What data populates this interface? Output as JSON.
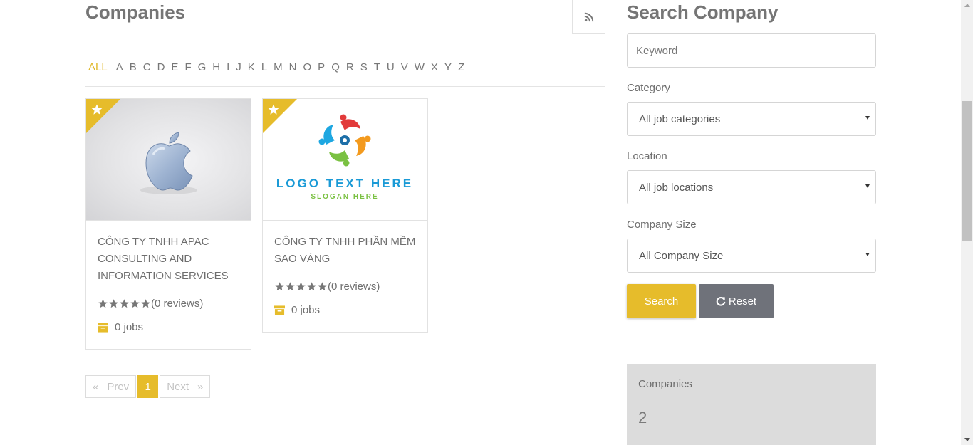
{
  "main": {
    "title": "Companies",
    "alphabet": [
      "ALL",
      "A",
      "B",
      "C",
      "D",
      "E",
      "F",
      "G",
      "H",
      "I",
      "J",
      "K",
      "L",
      "M",
      "N",
      "O",
      "P",
      "Q",
      "R",
      "S",
      "T",
      "U",
      "V",
      "W",
      "X",
      "Y",
      "Z"
    ],
    "active_letter": "ALL",
    "companies": [
      {
        "name": "CÔNG TY TNHH APAC CONSULTING AND INFORMATION SERVICES",
        "rating": 5,
        "reviews": "(0 reviews)",
        "jobs": "0 jobs",
        "featured": true,
        "logo": "apple-logo"
      },
      {
        "name": "CÔNG TY TNHH PHẦN MỀM SAO VÀNG",
        "rating": 5,
        "reviews": "(0 reviews)",
        "jobs": "0 jobs",
        "featured": true,
        "logo": "people-circle-logo",
        "logo_text": "LOGO TEXT HERE",
        "logo_slogan": "SLOGAN HERE"
      }
    ],
    "pagination": {
      "prev": "Prev",
      "prev_arrow": "«",
      "current": "1",
      "next": "Next",
      "next_arrow": "»"
    }
  },
  "sidebar": {
    "title": "Search Company",
    "keyword_placeholder": "Keyword",
    "category_label": "Category",
    "category_value": "All job categories",
    "location_label": "Location",
    "location_value": "All job locations",
    "size_label": "Company Size",
    "size_value": "All Company Size",
    "search_label": "Search",
    "reset_label": "Reset",
    "stats": {
      "label": "Companies",
      "value": "2"
    }
  },
  "colors": {
    "accent": "#e6bc2b",
    "reset": "#6f727a",
    "text": "#6e6e6e",
    "stats_bg": "#dcdcdc"
  }
}
